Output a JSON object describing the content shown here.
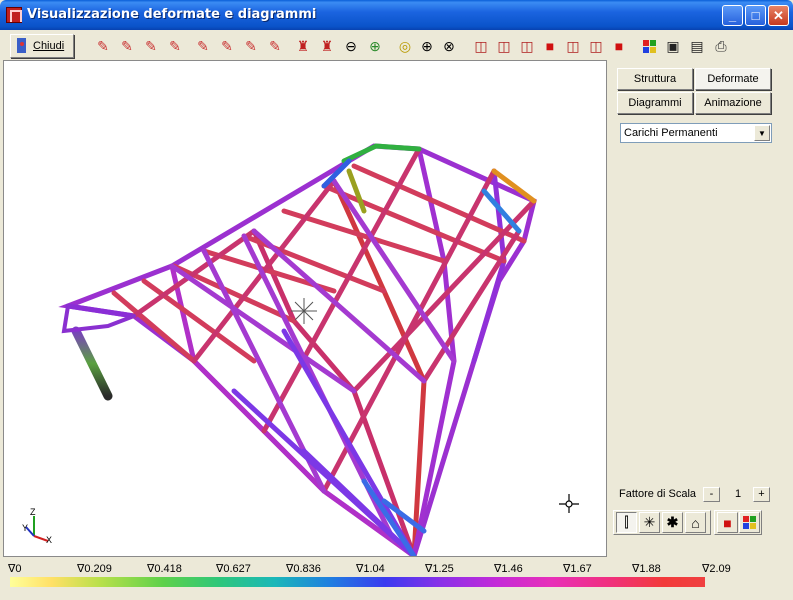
{
  "window": {
    "title": "Visualizzazione deformate e diagrammi"
  },
  "toolbar": {
    "close_label": "Chiudi",
    "icons": [
      "pencil-red",
      "pencil-red",
      "pencil-red",
      "pencil-red",
      "pencil-red",
      "pencil-red",
      "pencil-red",
      "pencil-red",
      "figure-red",
      "figure-red",
      "zoom-out",
      "zoom-green",
      "zoom-yellow",
      "zoom-in",
      "zoom-fit",
      "cube-view",
      "cube-view",
      "cube-view",
      "cube-view-red",
      "cube-view",
      "cube-view",
      "cube-view-red",
      "color-grid",
      "save",
      "save-pdf",
      "print"
    ]
  },
  "panel": {
    "tabs": {
      "struttura": "Struttura",
      "deformate": "Deformate",
      "diagrammi": "Diagrammi",
      "animazione": "Animazione"
    },
    "load_case": "Carichi Permanenti",
    "scale_label": "Fattore di Scala",
    "scale_minus": "-",
    "scale_value": "1",
    "scale_plus": "+"
  },
  "axes": {
    "z": "Z",
    "y": "Y",
    "x": "X"
  },
  "legend": {
    "labels": [
      "∇0",
      "∇0.209",
      "∇0.418",
      "∇0.627",
      "∇0.836",
      "∇1.04",
      "∇1.25",
      "∇1.46",
      "∇1.67",
      "∇1.88",
      "∇2.09"
    ]
  },
  "colors": {
    "title_bar": "#0a53c9",
    "viewport_bg": "#ffffff",
    "window_bg": "#ece9d8"
  }
}
